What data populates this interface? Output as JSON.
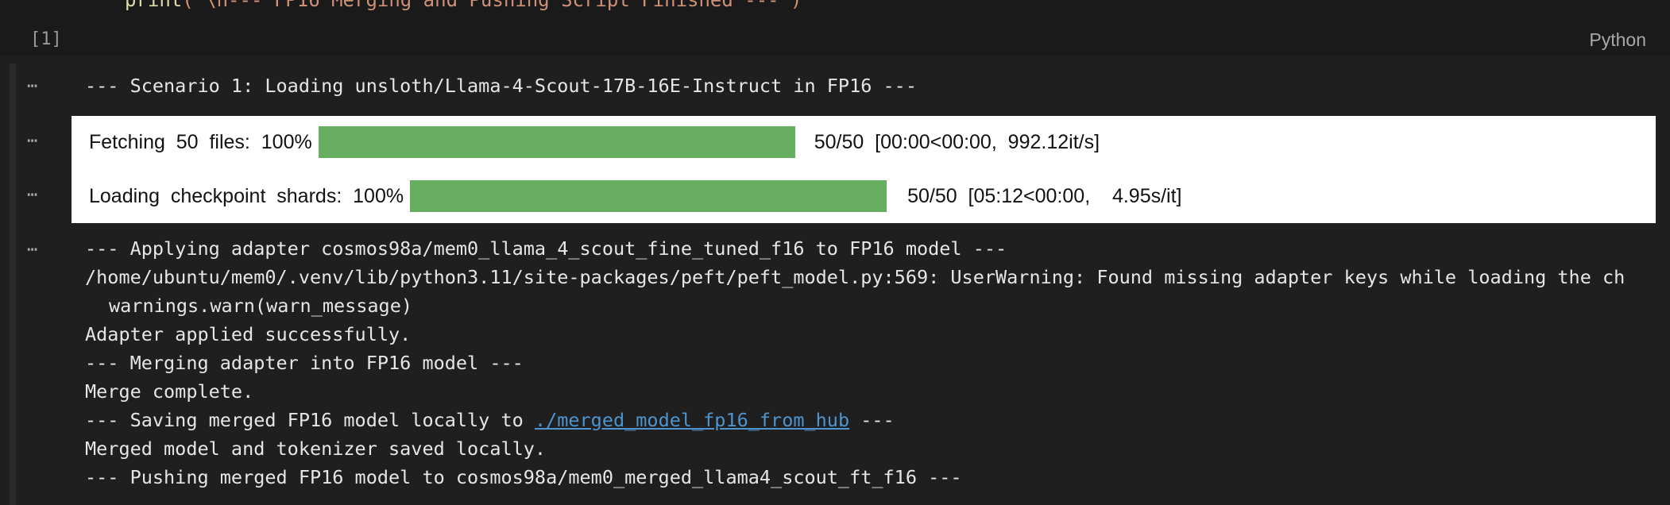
{
  "code_cell": {
    "print_func": "print",
    "print_arg": "(\"\\n--- FP16 Merging and Pushing Script Finished ---\")",
    "execution_count": "[1]",
    "language": "Python"
  },
  "output": {
    "ellipsis": "⋯",
    "scenario_line": "--- Scenario 1: Loading unsloth/Llama-4-Scout-17B-16E-Instruct in FP16 ---",
    "progress": [
      {
        "label": "Fetching  50  files:  100%",
        "fraction": 1.0,
        "stats": "50/50  [00:00<00:00,  992.12it/s]"
      },
      {
        "label": "Loading  checkpoint  shards:  100%",
        "fraction": 1.0,
        "stats": "50/50  [05:12<00:00,    4.95s/it]"
      }
    ],
    "log_lines": {
      "l1": "--- Applying adapter cosmos98a/mem0_llama_4_scout_fine_tuned_f16 to FP16 model ---",
      "l2": "/home/ubuntu/mem0/.venv/lib/python3.11/site-packages/peft/peft_model.py:569: UserWarning: Found missing adapter keys while loading the ch",
      "l3": "warnings.warn(warn_message)",
      "l4": "Adapter applied successfully.",
      "l5": "--- Merging adapter into FP16 model ---",
      "l6": "Merge complete.",
      "l7_prefix": "--- Saving merged FP16 model locally to ",
      "l7_link": "./merged_model_fp16_from_hub",
      "l7_suffix": " ---",
      "l8": "Merged model and tokenizer saved locally.",
      "l9": "--- Pushing merged FP16 model to cosmos98a/mem0_merged_llama4_scout_ft_f16 ---"
    }
  },
  "colors": {
    "background": "#1f1f1f",
    "progress_fill": "#66ad5f",
    "link": "#4e94ce"
  }
}
